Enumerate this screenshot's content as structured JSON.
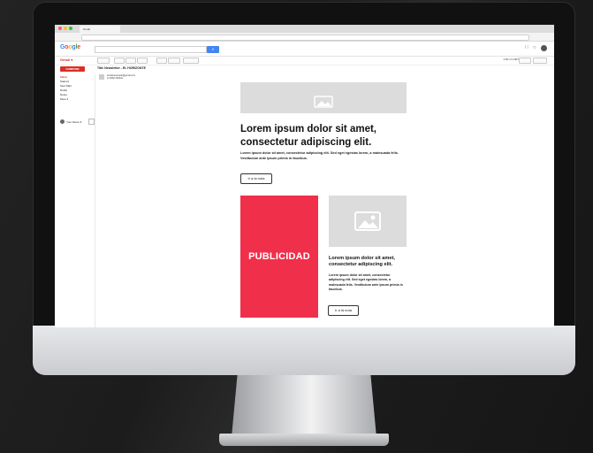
{
  "browser": {
    "tab_title": "Gmail"
  },
  "gmail": {
    "logo_letters": [
      {
        "ch": "G",
        "color": "#4285f4"
      },
      {
        "ch": "o",
        "color": "#ea4335"
      },
      {
        "ch": "o",
        "color": "#fbbc05"
      },
      {
        "ch": "g",
        "color": "#4285f4"
      },
      {
        "ch": "l",
        "color": "#34a853"
      },
      {
        "ch": "e",
        "color": "#ea4335"
      }
    ],
    "gmail_label": "Gmail ▾",
    "compose": "COMPOSE",
    "subject": "Title Newsletter - EL HORIZONTE",
    "pager": "1-50 of 1,807",
    "search_button_icon": "search-icon",
    "sidebar": [
      "Inbox",
      "Starred",
      "Sent Mail",
      "Drafts",
      "Notes",
      "More ▾"
    ],
    "chat_name": "Your Name ▾",
    "sender_name": "senderexample@gmail.com",
    "sender_sub": "to Pablo Molina"
  },
  "newsletter": {
    "hero_title": "Lorem ipsum dolor sit amet, consectetur adipiscing elit.",
    "hero_body": "Lorem ipsum dolor sit amet, consectetur adipiscing elit. Sed eget egestas lorem, a malesuada felis. Vestibulum ante ipsum primis in faucibus.",
    "hero_button": "Ir a la nota",
    "ad_label": "PUBLICIDAD",
    "side_title": "Lorem ipsum dolor sit amet, consectetur adipiscing elit.",
    "side_body": "Lorem ipsum dolor sit amet, consectetur adipiscing elit. Sed eget egestas lorem, a malesuada felis. Vestibulum ante ipsum primis in faucibus.",
    "side_button": "Ir a la nota"
  },
  "colors": {
    "ad_red": "#f0304b",
    "gmail_red": "#d93025",
    "search_blue": "#4285f4"
  }
}
